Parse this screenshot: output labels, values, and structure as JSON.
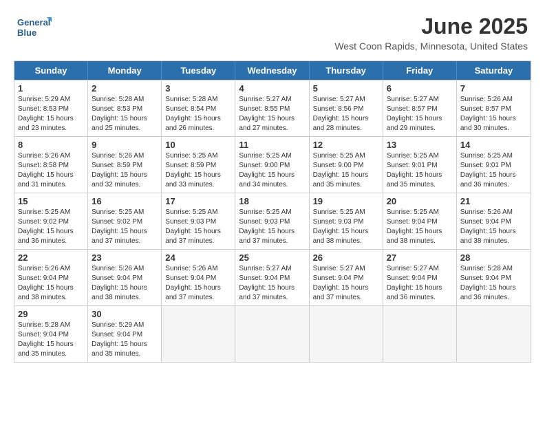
{
  "header": {
    "logo_line1": "General",
    "logo_line2": "Blue",
    "month": "June 2025",
    "location": "West Coon Rapids, Minnesota, United States"
  },
  "calendar": {
    "days_of_week": [
      "Sunday",
      "Monday",
      "Tuesday",
      "Wednesday",
      "Thursday",
      "Friday",
      "Saturday"
    ],
    "weeks": [
      [
        {
          "day": "",
          "empty": true
        },
        {
          "day": "",
          "empty": true
        },
        {
          "day": "",
          "empty": true
        },
        {
          "day": "",
          "empty": true
        },
        {
          "day": "",
          "empty": true
        },
        {
          "day": "",
          "empty": true
        },
        {
          "day": "",
          "empty": true
        }
      ],
      [
        {
          "num": "1",
          "sunrise": "5:29 AM",
          "sunset": "8:53 PM",
          "daylight": "15 hours and 23 minutes."
        },
        {
          "num": "2",
          "sunrise": "5:28 AM",
          "sunset": "8:53 PM",
          "daylight": "15 hours and 25 minutes."
        },
        {
          "num": "3",
          "sunrise": "5:28 AM",
          "sunset": "8:54 PM",
          "daylight": "15 hours and 26 minutes."
        },
        {
          "num": "4",
          "sunrise": "5:27 AM",
          "sunset": "8:55 PM",
          "daylight": "15 hours and 27 minutes."
        },
        {
          "num": "5",
          "sunrise": "5:27 AM",
          "sunset": "8:56 PM",
          "daylight": "15 hours and 28 minutes."
        },
        {
          "num": "6",
          "sunrise": "5:27 AM",
          "sunset": "8:57 PM",
          "daylight": "15 hours and 29 minutes."
        },
        {
          "num": "7",
          "sunrise": "5:26 AM",
          "sunset": "8:57 PM",
          "daylight": "15 hours and 30 minutes."
        }
      ],
      [
        {
          "num": "8",
          "sunrise": "5:26 AM",
          "sunset": "8:58 PM",
          "daylight": "15 hours and 31 minutes."
        },
        {
          "num": "9",
          "sunrise": "5:26 AM",
          "sunset": "8:59 PM",
          "daylight": "15 hours and 32 minutes."
        },
        {
          "num": "10",
          "sunrise": "5:25 AM",
          "sunset": "8:59 PM",
          "daylight": "15 hours and 33 minutes."
        },
        {
          "num": "11",
          "sunrise": "5:25 AM",
          "sunset": "9:00 PM",
          "daylight": "15 hours and 34 minutes."
        },
        {
          "num": "12",
          "sunrise": "5:25 AM",
          "sunset": "9:00 PM",
          "daylight": "15 hours and 35 minutes."
        },
        {
          "num": "13",
          "sunrise": "5:25 AM",
          "sunset": "9:01 PM",
          "daylight": "15 hours and 35 minutes."
        },
        {
          "num": "14",
          "sunrise": "5:25 AM",
          "sunset": "9:01 PM",
          "daylight": "15 hours and 36 minutes."
        }
      ],
      [
        {
          "num": "15",
          "sunrise": "5:25 AM",
          "sunset": "9:02 PM",
          "daylight": "15 hours and 36 minutes."
        },
        {
          "num": "16",
          "sunrise": "5:25 AM",
          "sunset": "9:02 PM",
          "daylight": "15 hours and 37 minutes."
        },
        {
          "num": "17",
          "sunrise": "5:25 AM",
          "sunset": "9:03 PM",
          "daylight": "15 hours and 37 minutes."
        },
        {
          "num": "18",
          "sunrise": "5:25 AM",
          "sunset": "9:03 PM",
          "daylight": "15 hours and 37 minutes."
        },
        {
          "num": "19",
          "sunrise": "5:25 AM",
          "sunset": "9:03 PM",
          "daylight": "15 hours and 38 minutes."
        },
        {
          "num": "20",
          "sunrise": "5:25 AM",
          "sunset": "9:04 PM",
          "daylight": "15 hours and 38 minutes."
        },
        {
          "num": "21",
          "sunrise": "5:26 AM",
          "sunset": "9:04 PM",
          "daylight": "15 hours and 38 minutes."
        }
      ],
      [
        {
          "num": "22",
          "sunrise": "5:26 AM",
          "sunset": "9:04 PM",
          "daylight": "15 hours and 38 minutes."
        },
        {
          "num": "23",
          "sunrise": "5:26 AM",
          "sunset": "9:04 PM",
          "daylight": "15 hours and 38 minutes."
        },
        {
          "num": "24",
          "sunrise": "5:26 AM",
          "sunset": "9:04 PM",
          "daylight": "15 hours and 37 minutes."
        },
        {
          "num": "25",
          "sunrise": "5:27 AM",
          "sunset": "9:04 PM",
          "daylight": "15 hours and 37 minutes."
        },
        {
          "num": "26",
          "sunrise": "5:27 AM",
          "sunset": "9:04 PM",
          "daylight": "15 hours and 37 minutes."
        },
        {
          "num": "27",
          "sunrise": "5:27 AM",
          "sunset": "9:04 PM",
          "daylight": "15 hours and 36 minutes."
        },
        {
          "num": "28",
          "sunrise": "5:28 AM",
          "sunset": "9:04 PM",
          "daylight": "15 hours and 36 minutes."
        }
      ],
      [
        {
          "num": "29",
          "sunrise": "5:28 AM",
          "sunset": "9:04 PM",
          "daylight": "15 hours and 35 minutes."
        },
        {
          "num": "30",
          "sunrise": "5:29 AM",
          "sunset": "9:04 PM",
          "daylight": "15 hours and 35 minutes."
        },
        {
          "day": "",
          "empty": true
        },
        {
          "day": "",
          "empty": true
        },
        {
          "day": "",
          "empty": true
        },
        {
          "day": "",
          "empty": true
        },
        {
          "day": "",
          "empty": true
        }
      ]
    ]
  }
}
